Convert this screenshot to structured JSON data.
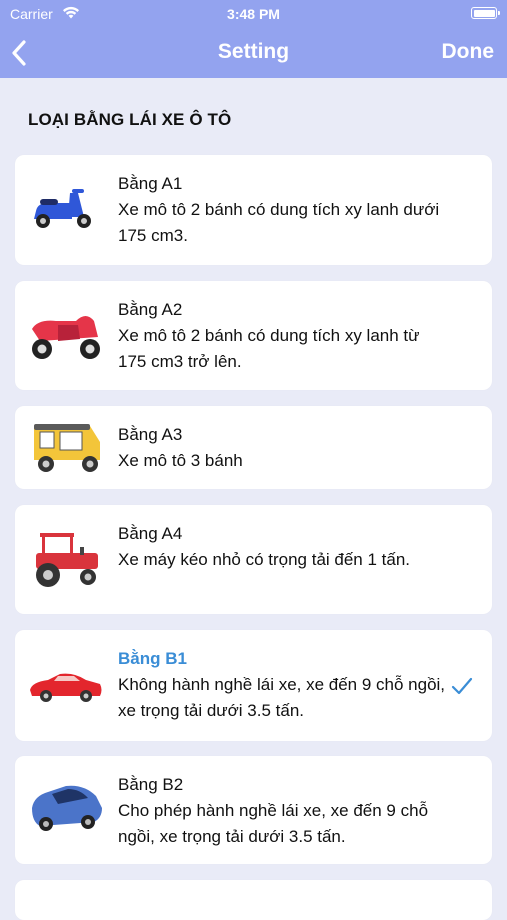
{
  "status": {
    "carrier": "Carrier",
    "time": "3:48 PM"
  },
  "nav": {
    "title": "Setting",
    "done_label": "Done"
  },
  "section": {
    "title": "LOẠI BẰNG LÁI XE Ô TÔ"
  },
  "licenses": [
    {
      "name": "Bằng A1",
      "desc": "Xe mô tô 2 bánh có dung tích xy lanh dưới 175 cm3.",
      "icon": "scooter-icon",
      "color": "#2f57d8"
    },
    {
      "name": "Bằng A2",
      "desc": "Xe mô tô 2 bánh có dung tích xy lanh từ 175 cm3 trở lên.",
      "icon": "motorcycle-icon",
      "color": "#e53549"
    },
    {
      "name": "Bằng A3",
      "desc": "Xe mô tô 3 bánh",
      "icon": "tuk-tuk-icon",
      "color": "#f3c53a"
    },
    {
      "name": "Bằng A4",
      "desc": "Xe máy kéo nhỏ có trọng tải đến 1 tấn.",
      "icon": "tractor-icon",
      "color": "#d9343c"
    },
    {
      "name": "Bằng B1",
      "desc": "Không hành nghề lái xe, xe đến 9 chỗ ngồi, xe trọng tải dưới 3.5 tấn.",
      "icon": "sports-car-icon",
      "color": "#e3262d",
      "selected": true
    },
    {
      "name": "Bằng B2",
      "desc": "Cho phép hành nghề lái xe, xe đến 9 chỗ ngồi, xe trọng tải dưới 3.5 tấn.",
      "icon": "sedan-icon",
      "color": "#4b74c9"
    }
  ],
  "colors": {
    "nav_bg": "#93a3ef",
    "page_bg": "#e9ebf7",
    "selected_text": "#3a8dd6",
    "check": "#3a8dd6"
  }
}
